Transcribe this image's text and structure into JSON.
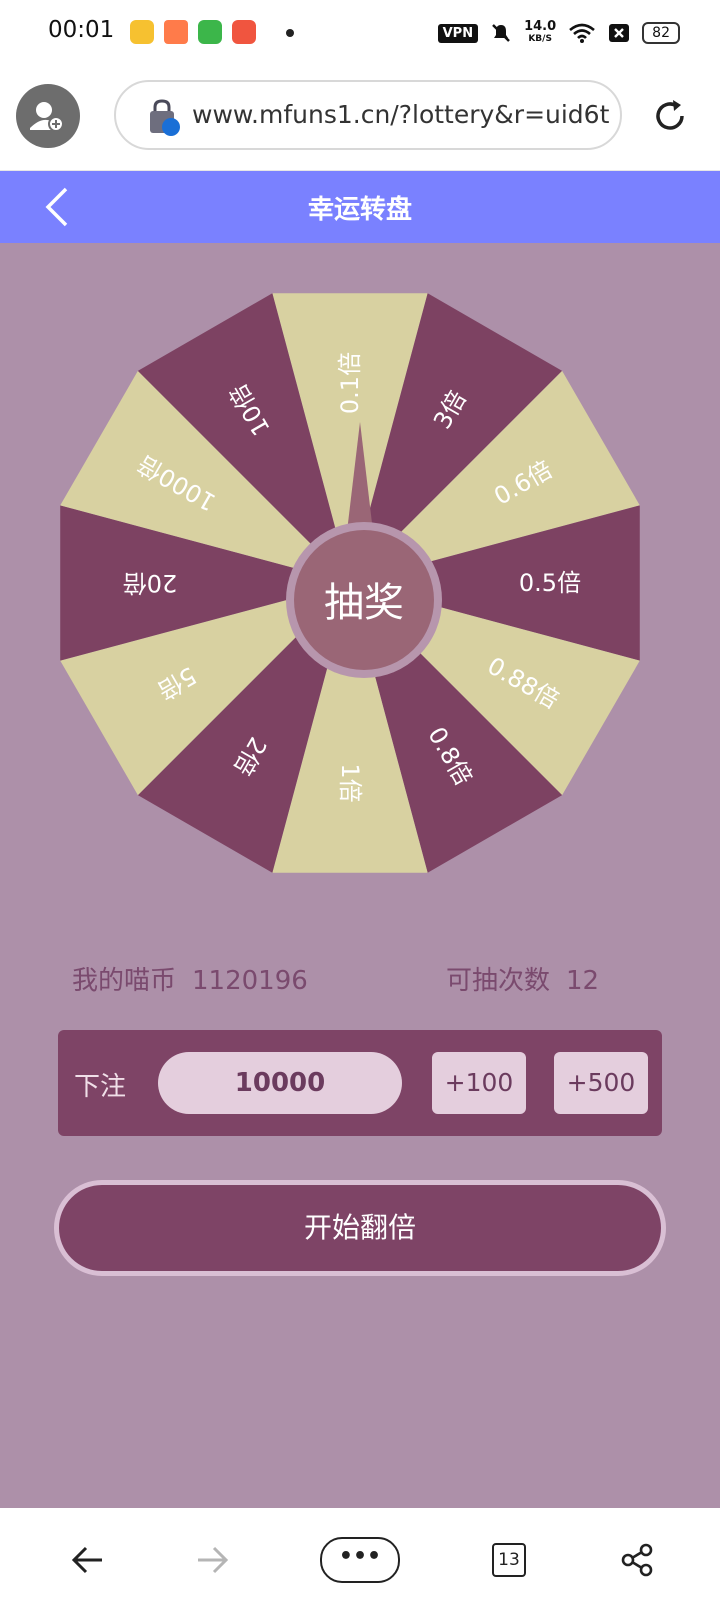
{
  "status_bar": {
    "time": "00:01",
    "vpn": "VPN",
    "net_speed": "14.0",
    "net_unit": "KB/S",
    "battery": "82"
  },
  "browser": {
    "url": "www.mfuns1.cn/?lottery&r=uid6t",
    "tab_count": "13"
  },
  "page": {
    "title": "幸运转盘",
    "draw_button": "抽奖"
  },
  "wheel": {
    "segments": [
      "0.1倍",
      "3倍",
      "0.6倍",
      "0.5倍",
      "0.88倍",
      "0.8倍",
      "1倍",
      "2倍",
      "5倍",
      "20倍",
      "1000倍",
      "10倍"
    ],
    "colors": {
      "dark": "#7d4262",
      "light": "#d8d1a1",
      "hub": "#9a6676",
      "hub_ring": "#b796ad"
    }
  },
  "stats": {
    "coins_label": "我的喵币",
    "coins_value": "1120196",
    "draws_label": "可抽次数",
    "draws_value": "12"
  },
  "bet": {
    "label": "下注",
    "amount": "10000",
    "add_100": "+100",
    "add_500": "+500"
  },
  "start_button": "开始翻倍",
  "nav": {
    "more": "•••"
  }
}
